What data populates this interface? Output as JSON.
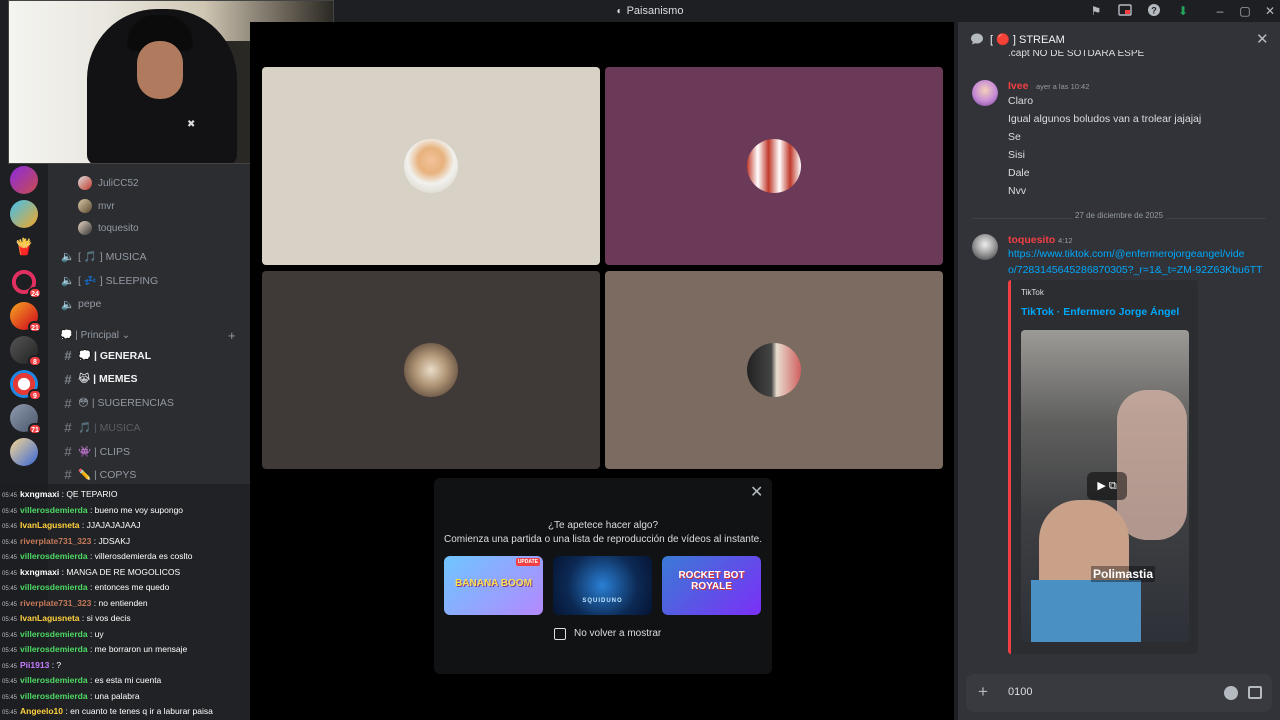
{
  "window": {
    "title": "Paisanismo"
  },
  "titlebar_icons": [
    "inbox-icon",
    "picture-in-picture-icon",
    "help-icon",
    "download-icon",
    "minimize-icon",
    "maximize-icon",
    "close-icon"
  ],
  "server_badges": [
    "24",
    "21",
    "8",
    "9",
    "71"
  ],
  "voice_users": [
    "JuliCC52",
    "mvr",
    "toquesito"
  ],
  "voice_channels": [
    {
      "name": "[ 🎵 ] MUSICA"
    },
    {
      "name": "[ 💤 ] SLEEPING"
    },
    {
      "name": "pepe"
    }
  ],
  "category": {
    "label": "💭 | Principal ⌄"
  },
  "text_channels": [
    {
      "name": "💭 | GENERAL",
      "state": "active"
    },
    {
      "name": "😹 | MEMES",
      "state": "active"
    },
    {
      "name": "😳 | SUGERENCIAS",
      "state": "normal"
    },
    {
      "name": "🎵 | MUSICA",
      "state": "muted"
    },
    {
      "name": "👾 | CLIPS",
      "state": "normal"
    },
    {
      "name": "✏️ | COPYS",
      "state": "normal"
    }
  ],
  "stream_chat": [
    {
      "user": "kxngmaxi",
      "color": "#ffffff",
      "text": " : QE TEPARIO"
    },
    {
      "user": "villerosdemierda",
      "color": "#4dd964",
      "text": " : bueno me voy supongo"
    },
    {
      "user": "IvanLagusneta",
      "color": "#ffd23f",
      "text": " : JJAJAJAJAAJ"
    },
    {
      "user": "riverplate731_323",
      "color": "#c47a5a",
      "text": " : JDSAKJ"
    },
    {
      "user": "villerosdemierda",
      "color": "#4dd964",
      "text": " : villerosdemierda es coslto"
    },
    {
      "user": "kxngmaxi",
      "color": "#ffffff",
      "text": " : MANGA DE RE MOGOLICOS"
    },
    {
      "user": "villerosdemierda",
      "color": "#4dd964",
      "text": " : entonces me quedo"
    },
    {
      "user": "riverplate731_323",
      "color": "#c47a5a",
      "text": " : no entienden"
    },
    {
      "user": "IvanLagusneta",
      "color": "#ffd23f",
      "text": " : si vos decis"
    },
    {
      "user": "villerosdemierda",
      "color": "#4dd964",
      "text": " : uy"
    },
    {
      "user": "villerosdemierda",
      "color": "#4dd964",
      "text": " : me borraron un mensaje"
    },
    {
      "user": "Pii1913",
      "color": "#c77dff",
      "text": " : ?"
    },
    {
      "user": "villerosdemierda",
      "color": "#4dd964",
      "text": " : es esta mi cuenta"
    },
    {
      "user": "villerosdemierda",
      "color": "#4dd964",
      "text": " : una palabra"
    },
    {
      "user": "Angeelo10",
      "color": "#ffd23f",
      "text": " : en cuanto te tenes q ir a laburar paisa"
    }
  ],
  "stream_chat_timestamp": "05:45",
  "popup": {
    "question": "¿Te apetece hacer algo?",
    "subtitle": "Comienza una partida o una lista de reproducción de vídeos al instante.",
    "activities": [
      {
        "label": "BANANA BOOM",
        "tag": "UPDATE"
      },
      {
        "label": "SQUIDUNO"
      },
      {
        "label": "ROCKET BOT ROYALE"
      }
    ],
    "checkbox_label": "No volver a mostrar"
  },
  "right_panel": {
    "title": "[ 🔴 ] STREAM",
    "partial_top_line": ".cápt NO DE SOTDARA ESPE",
    "message1": {
      "user": "Ivee",
      "time": "ayer a las 10:42",
      "lines": [
        "Claro",
        "Igual algunos boludos van a trolear jajajaj",
        "Se",
        "Sisi",
        "Dale",
        "Nvv"
      ]
    },
    "date_divider": "27 de diciembre de 2025",
    "message2": {
      "user": "toquesito",
      "time": "4:12",
      "link_line1": "https://www.tiktok.com/@enfermerojorgeangel/vide",
      "link_line2": "o/7283145645286870305?_r=1&_t=ZM-92Z63Kbu6TT",
      "embed_provider": "TikTok",
      "embed_title": "TikTok · Enfermero Jorge Ángel",
      "video_caption": "Polimastia"
    },
    "input_value": "0100"
  }
}
